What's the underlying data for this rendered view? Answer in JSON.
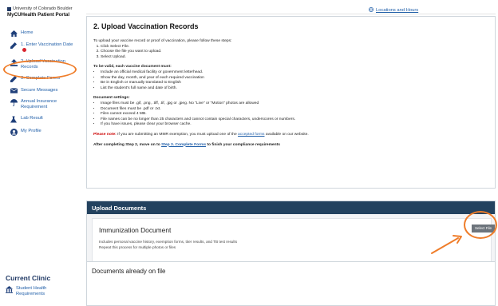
{
  "brand": {
    "university": "University of Colorado Boulder",
    "portal": "MyCUHealth Patient Portal"
  },
  "nav": {
    "home": "Home",
    "enter_vaccination_date": "1. Enter Vaccination Date",
    "upload_vaccination_records": "2. Upload Vaccination Records",
    "complete_forms": "3. Complete Forms",
    "secure_messages": "Secure Messages",
    "annual_insurance": "Annual Insurance Requirement",
    "lab_result": "Lab Result",
    "my_profile": "My Profile"
  },
  "sidebar_footer": {
    "current_clinic": "Current Clinic",
    "student_health": "Student Health Requirements"
  },
  "header": {
    "locations_link": "Locations and Hours"
  },
  "main": {
    "title": "2. Upload Vaccination Records",
    "intro": "To upload your vaccine record or proof of vaccination, please follow these steps:",
    "steps": [
      "Click Select File.",
      "Choose the file you want to upload.",
      "Select Upload."
    ],
    "valid_heading": "To be valid, each vaccine document must:",
    "valid_items": [
      "Include an official medical facility or government letterhead.",
      "Show the day, month, and year of each required vaccination",
      "Be in English or manually translated to English",
      "List the student's full name and date of birth."
    ],
    "settings_heading": "Document settings:",
    "settings_items": [
      "Image files must be .gif, .png, .tiff, .tif, .jpg or .jpeg. No \"Live\" or \"Motion\" photos are allowed",
      "Document files must be .pdf or .txt.",
      "Files cannot exceed 4 MB.",
      "File names can be no longer than 25 characters and cannot contain special characters, underscores or numbers.",
      "If you have issues, please clear your browser cache."
    ],
    "note_label": "Please note:",
    "note_text_1": " If you are submitting an MMR exemption, you must upload one of the ",
    "note_link": "accepted forms",
    "note_text_2": " available on our website.",
    "after_text_1": "After completing Step 2, move on to ",
    "after_link": "Step 3. Complete Forms",
    "after_text_2": " to finish your compliance requirements"
  },
  "upload": {
    "header": "Upload Documents",
    "doc_title": "Immunization Document",
    "doc_desc_1": "Includes personal vaccine history, exemption forms, titer results, and TB test results",
    "doc_desc_2": "Repeat this process for multiple photos or files",
    "select_file": "Select File"
  },
  "documents_on_file": {
    "title": "Documents already on file"
  },
  "colors": {
    "accent": "#1f5ea8",
    "header_bar": "#23425f",
    "highlight": "#ef7d2a",
    "alert_dot": "#d9232d"
  }
}
